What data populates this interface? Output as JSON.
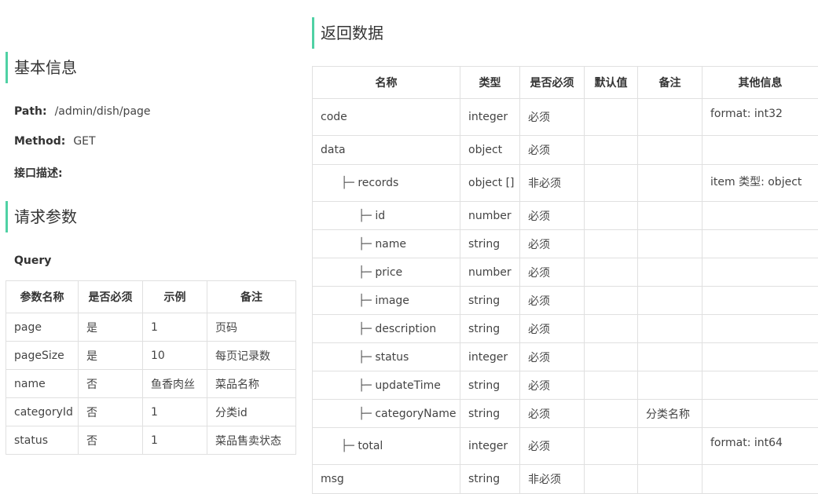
{
  "basic": {
    "title": "基本信息",
    "path_label": "Path:",
    "path_value": "/admin/dish/page",
    "method_label": "Method:",
    "method_value": "GET",
    "desc_label": "接口描述:"
  },
  "request": {
    "title": "请求参数",
    "query_label": "Query",
    "headers": [
      "参数名称",
      "是否必须",
      "示例",
      "备注"
    ],
    "rows": [
      [
        "page",
        "是",
        "1",
        "页码"
      ],
      [
        "pageSize",
        "是",
        "10",
        "每页记录数"
      ],
      [
        "name",
        "否",
        "鱼香肉丝",
        "菜品名称"
      ],
      [
        "categoryId",
        "否",
        "1",
        "分类id"
      ],
      [
        "status",
        "否",
        "1",
        "菜品售卖状态"
      ]
    ]
  },
  "response": {
    "title": "返回数据",
    "headers": [
      "名称",
      "类型",
      "是否必须",
      "默认值",
      "备注",
      "其他信息"
    ],
    "rows": [
      {
        "prefix": "",
        "name": "code",
        "type": "integer",
        "required": "必须",
        "default": "",
        "note": "",
        "other": "format: int32"
      },
      {
        "prefix": "",
        "name": "data",
        "type": "object",
        "required": "必须",
        "default": "",
        "note": "",
        "other": ""
      },
      {
        "prefix": "├─ ",
        "name": "records",
        "type": "object []",
        "required": "非必须",
        "default": "",
        "note": "",
        "other": "item 类型: object"
      },
      {
        "prefix": "├─ ",
        "name": "id",
        "type": "number",
        "required": "必须",
        "default": "",
        "note": "",
        "other": ""
      },
      {
        "prefix": "├─ ",
        "name": "name",
        "type": "string",
        "required": "必须",
        "default": "",
        "note": "",
        "other": ""
      },
      {
        "prefix": "├─ ",
        "name": "price",
        "type": "number",
        "required": "必须",
        "default": "",
        "note": "",
        "other": ""
      },
      {
        "prefix": "├─ ",
        "name": "image",
        "type": "string",
        "required": "必须",
        "default": "",
        "note": "",
        "other": ""
      },
      {
        "prefix": "├─ ",
        "name": "description",
        "type": "string",
        "required": "必须",
        "default": "",
        "note": "",
        "other": ""
      },
      {
        "prefix": "├─ ",
        "name": "status",
        "type": "integer",
        "required": "必须",
        "default": "",
        "note": "",
        "other": ""
      },
      {
        "prefix": "├─ ",
        "name": "updateTime",
        "type": "string",
        "required": "必须",
        "default": "",
        "note": "",
        "other": ""
      },
      {
        "prefix": "├─ ",
        "name": "categoryName",
        "type": "string",
        "required": "必须",
        "default": "",
        "note": "分类名称",
        "other": ""
      },
      {
        "prefix": "├─ ",
        "name": "total",
        "type": "integer",
        "required": "必须",
        "default": "",
        "note": "",
        "other": "format: int64"
      },
      {
        "prefix": "",
        "name": "msg",
        "type": "string",
        "required": "非必须",
        "default": "",
        "note": "",
        "other": ""
      }
    ]
  },
  "colors": {
    "accent": "#4fd1a4",
    "border": "#e0e0e0"
  }
}
